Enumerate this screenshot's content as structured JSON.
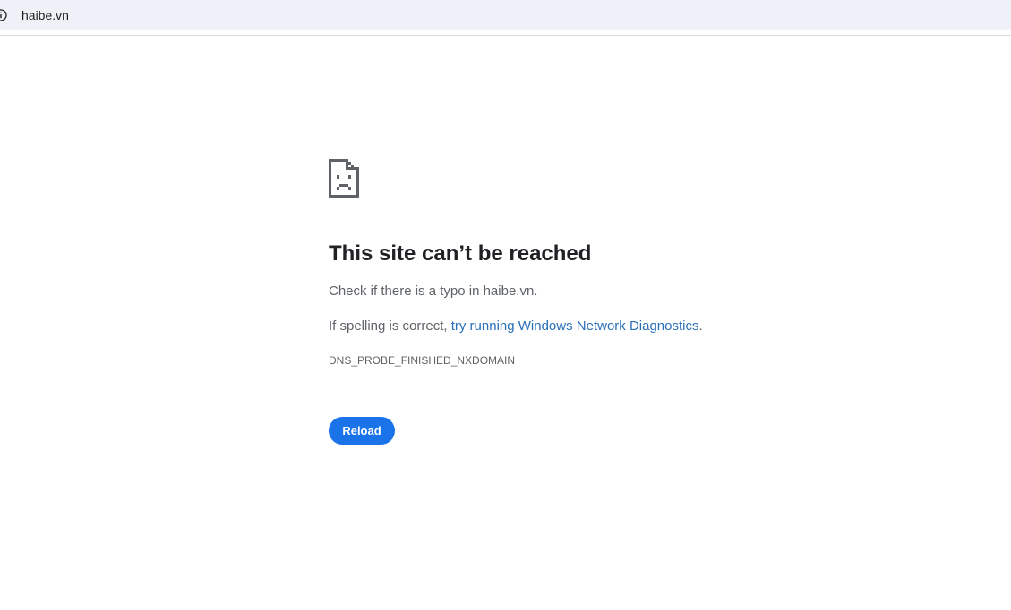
{
  "browser": {
    "url": "haibe.vn",
    "info_icon": "info-icon"
  },
  "error_page": {
    "icon": "sad-page-icon",
    "title": "This site can’t be reached",
    "typo_message": "Check if there is a typo in haibe.vn.",
    "spelling_prefix": "If spelling is correct, ",
    "diagnostics_link": "try running Windows Network Diagnostics",
    "spelling_suffix": ".",
    "error_code": "DNS_PROBE_FINISHED_NXDOMAIN",
    "reload_label": "Reload"
  },
  "colors": {
    "accent": "#1a73e8",
    "link": "#2a6fb8",
    "title": "#202124",
    "body_text": "#5f6368",
    "address_bar_bg": "#eef1f8"
  }
}
